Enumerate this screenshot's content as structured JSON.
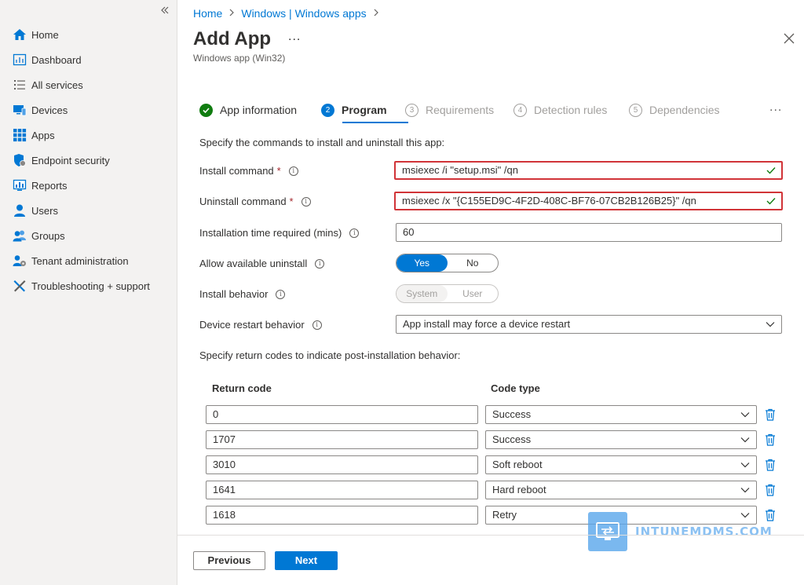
{
  "sidebar": {
    "collapse_icon": "double-chevron-left-icon",
    "items": [
      {
        "label": "Home",
        "icon": "home-icon"
      },
      {
        "label": "Dashboard",
        "icon": "dashboard-icon"
      },
      {
        "label": "All services",
        "icon": "list-icon"
      },
      {
        "label": "Devices",
        "icon": "devices-icon"
      },
      {
        "label": "Apps",
        "icon": "apps-grid-icon"
      },
      {
        "label": "Endpoint security",
        "icon": "shield-icon"
      },
      {
        "label": "Reports",
        "icon": "reports-icon"
      },
      {
        "label": "Users",
        "icon": "user-icon"
      },
      {
        "label": "Groups",
        "icon": "groups-icon"
      },
      {
        "label": "Tenant administration",
        "icon": "tenant-gear-icon"
      },
      {
        "label": "Troubleshooting + support",
        "icon": "tools-icon"
      }
    ]
  },
  "breadcrumb": [
    "Home",
    "Windows | Windows apps"
  ],
  "header": {
    "title": "Add App",
    "more": "...",
    "subtitle": "Windows app (Win32)"
  },
  "steps": [
    {
      "num": "",
      "label": "App information",
      "state": "done"
    },
    {
      "num": "2",
      "label": "Program",
      "state": "active"
    },
    {
      "num": "3",
      "label": "Requirements",
      "state": "todo"
    },
    {
      "num": "4",
      "label": "Detection rules",
      "state": "todo"
    },
    {
      "num": "5",
      "label": "Dependencies",
      "state": "todo"
    }
  ],
  "steps_more": "...",
  "form": {
    "intro": "Specify the commands to install and uninstall this app:",
    "install_label": "Install command",
    "install_value": "msiexec /i \"setup.msi\" /qn",
    "uninstall_label": "Uninstall command",
    "uninstall_value": "msiexec /x \"{C155ED9C-4F2D-408C-BF76-07CB2B126B25}\" /qn",
    "required_mark": "*",
    "info_glyph": "i",
    "time_label": "Installation time required (mins)",
    "time_value": "60",
    "allow_uninstall_label": "Allow available uninstall",
    "allow_uninstall_options": [
      "Yes",
      "No"
    ],
    "allow_uninstall_selected": "Yes",
    "behavior_label": "Install behavior",
    "behavior_options": [
      "System",
      "User"
    ],
    "behavior_selected": "System",
    "restart_label": "Device restart behavior",
    "restart_value": "App install may force a device restart",
    "return_intro": "Specify return codes to indicate post-installation behavior:"
  },
  "return_codes": {
    "headers": [
      "Return code",
      "Code type"
    ],
    "rows": [
      {
        "code": "0",
        "type": "Success"
      },
      {
        "code": "1707",
        "type": "Success"
      },
      {
        "code": "3010",
        "type": "Soft reboot"
      },
      {
        "code": "1641",
        "type": "Hard reboot"
      },
      {
        "code": "1618",
        "type": "Retry"
      }
    ]
  },
  "footer": {
    "previous": "Previous",
    "next": "Next"
  },
  "watermark": {
    "text": "INTUNEMDMS.COM",
    "icon": "monitor-sync-icon"
  },
  "colors": {
    "accent": "#0078d4",
    "success": "#107c10",
    "highlight": "#d13438",
    "sidebar_bg": "#f3f2f1"
  }
}
